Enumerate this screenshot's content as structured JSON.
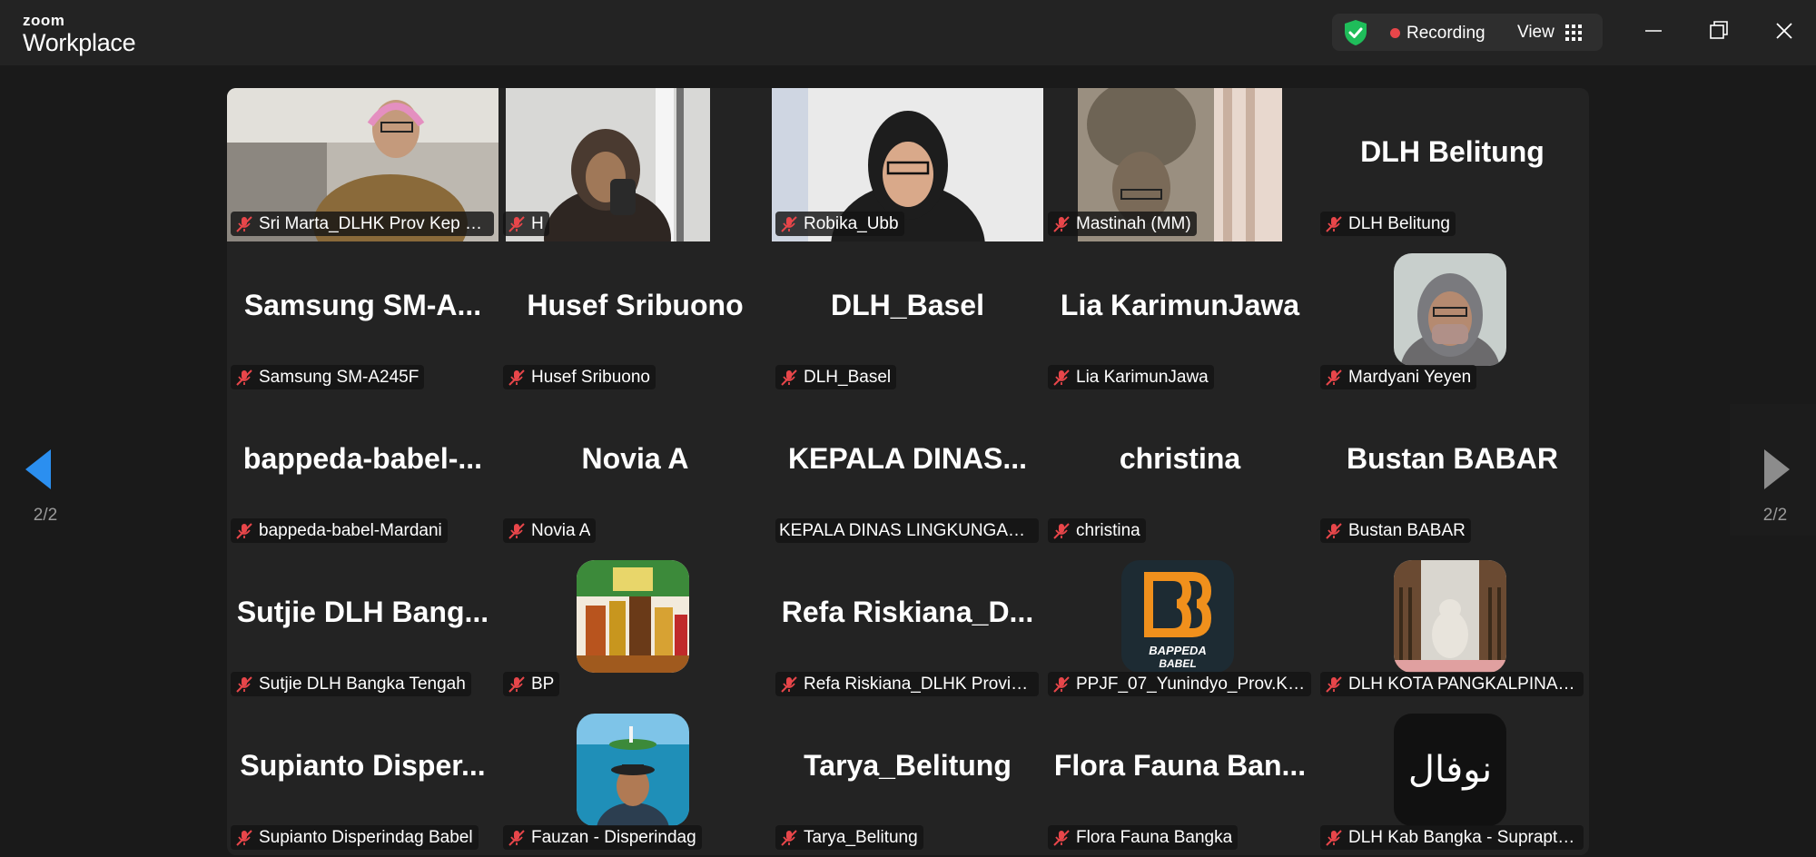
{
  "app": {
    "logo_line1": "zoom",
    "logo_line2": "Workplace"
  },
  "status": {
    "recording_label": "Recording",
    "view_label": "View",
    "shield_color": "#1fbd5a",
    "record_color": "#e8464a"
  },
  "navigation": {
    "left_page": "2/2",
    "right_page": "2/2",
    "accent": "#2b8ff0"
  },
  "participants": [
    {
      "name": "Sri Marta_DLHK Prov Kep Ba...",
      "display": "",
      "kind": "video",
      "muted": true
    },
    {
      "name": "H",
      "display": "",
      "kind": "video",
      "muted": true
    },
    {
      "name": "Robika_Ubb",
      "display": "",
      "kind": "video",
      "muted": true
    },
    {
      "name": "Mastinah (MM)",
      "display": "",
      "kind": "video",
      "muted": true
    },
    {
      "name": "DLH Belitung",
      "display": "DLH Belitung",
      "kind": "name",
      "muted": true
    },
    {
      "name": "Samsung SM-A245F",
      "display": "Samsung  SM-A...",
      "kind": "name",
      "muted": true
    },
    {
      "name": "Husef Sribuono",
      "display": "Husef Sribuono",
      "kind": "name",
      "muted": true
    },
    {
      "name": "DLH_Basel",
      "display": "DLH_Basel",
      "kind": "name",
      "muted": true
    },
    {
      "name": "Lia KarimunJawa",
      "display": "Lia KarimunJawa",
      "kind": "name",
      "muted": true
    },
    {
      "name": "Mardyani Yeyen",
      "display": "",
      "kind": "avatar",
      "avatar": "woman-mask-avatar",
      "muted": true
    },
    {
      "name": "bappeda-babel-Mardani",
      "display": "bappeda-babel-...",
      "kind": "name",
      "muted": true
    },
    {
      "name": "Novia A",
      "display": "Novia A",
      "kind": "name",
      "muted": true
    },
    {
      "name": "KEPALA DINAS LINGKUNGAN ...",
      "display": "KEPALA  DINAS...",
      "kind": "name",
      "muted": false
    },
    {
      "name": "christina",
      "display": "christina",
      "kind": "name",
      "muted": true
    },
    {
      "name": "Bustan BABAR",
      "display": "Bustan BABAR",
      "kind": "name",
      "muted": true
    },
    {
      "name": "Sutjie DLH Bangka Tengah",
      "display": "Sutjie  DLH  Bang...",
      "kind": "name",
      "muted": true
    },
    {
      "name": "BP",
      "display": "",
      "kind": "avatar",
      "avatar": "products-avatar",
      "muted": true
    },
    {
      "name": "Refa Riskiana_DLHK Provinsi...",
      "display": "Refa  Riskiana_D...",
      "kind": "name",
      "muted": true
    },
    {
      "name": "PPJF_07_Yunindyo_Prov.Kep....",
      "display": "",
      "kind": "avatar",
      "avatar": "bappeda-logo-avatar",
      "avatar_text": "BAPPEDA BABEL",
      "muted": true
    },
    {
      "name": "DLH KOTA PANGKALPINANG",
      "display": "",
      "kind": "avatar",
      "avatar": "cat-window-avatar",
      "muted": true
    },
    {
      "name": "Supianto Disperindag Babel",
      "display": "Supianto  Disper...",
      "kind": "name",
      "muted": true
    },
    {
      "name": "Fauzan - Disperindag",
      "display": "",
      "kind": "avatar",
      "avatar": "beach-selfie-avatar",
      "muted": true
    },
    {
      "name": "Tarya_Belitung",
      "display": "Tarya_Belitung",
      "kind": "name",
      "muted": true
    },
    {
      "name": "Flora Fauna Bangka",
      "display": "Flora  Fauna  Ban...",
      "kind": "name",
      "muted": true
    },
    {
      "name": "DLH Kab Bangka - Suprapti J...",
      "display": "",
      "kind": "avatar",
      "avatar": "arabic-text-avatar",
      "avatar_text": "نوفال",
      "muted": true
    }
  ]
}
